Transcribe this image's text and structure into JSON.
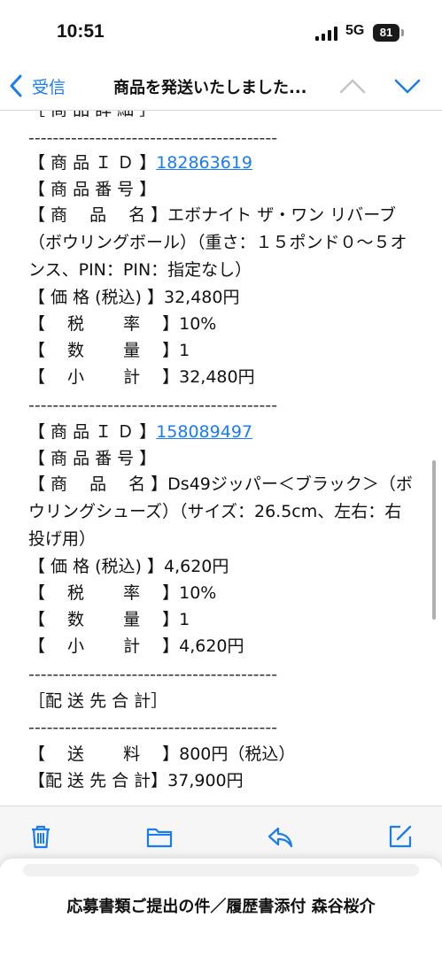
{
  "status_bar": {
    "time": "10:51",
    "network": "5G",
    "battery": "81"
  },
  "nav": {
    "back_label": "受信",
    "subject": "商品を発送いたしました..."
  },
  "body_lines": [
    "［ 商 品 詳 細 ］",
    "-----------------------------------------",
    "【 商 品 Ｉ Ｄ 】",
    "【 商 品 番 号 】",
    "【 商　 品　 名 】エボナイト ザ・ワン リバーブ（ボウリングボール）（重さ：１５ポンド０〜５オンス、PIN：PIN：指定なし）",
    "【 価 格 (税込) 】32,480円",
    "【　 税　　 率　 】10%",
    "【　 数　　 量　 】1",
    "【　 小　　 計　 】32,480円",
    "-----------------------------------------",
    "【 商 品 Ｉ Ｄ 】",
    "【 商 品 番 号 】",
    "【 商　 品　 名 】Ds49ジッパー＜ブラック＞（ボウリングシューズ）（サイズ：26.5cm、左右：右投げ用）",
    "【 価 格 (税込) 】4,620円",
    "【　 税　　 率　 】10%",
    "【　 数　　 量　 】1",
    "【　 小　　 計　 】4,620円",
    "-----------------------------------------",
    "［配 送 先 合 計］",
    "-----------------------------------------",
    "【　 送　　 料　 】800円（税込）",
    "【配 送 先 合 計】37,900円",
    "--------------------------------------------------------"
  ],
  "links": {
    "product_id_1": "182863619",
    "product_id_2": "158089497"
  },
  "toolbar": {
    "icons": [
      "trash-icon",
      "folder-icon",
      "reply-icon",
      "compose-icon"
    ]
  },
  "sheet": {
    "title": "応募書類ご提出の件／履歴書添付 森谷桜介"
  },
  "colors": {
    "accent": "#1a7cf2",
    "toolbar_bg": "#f6f6f6"
  }
}
